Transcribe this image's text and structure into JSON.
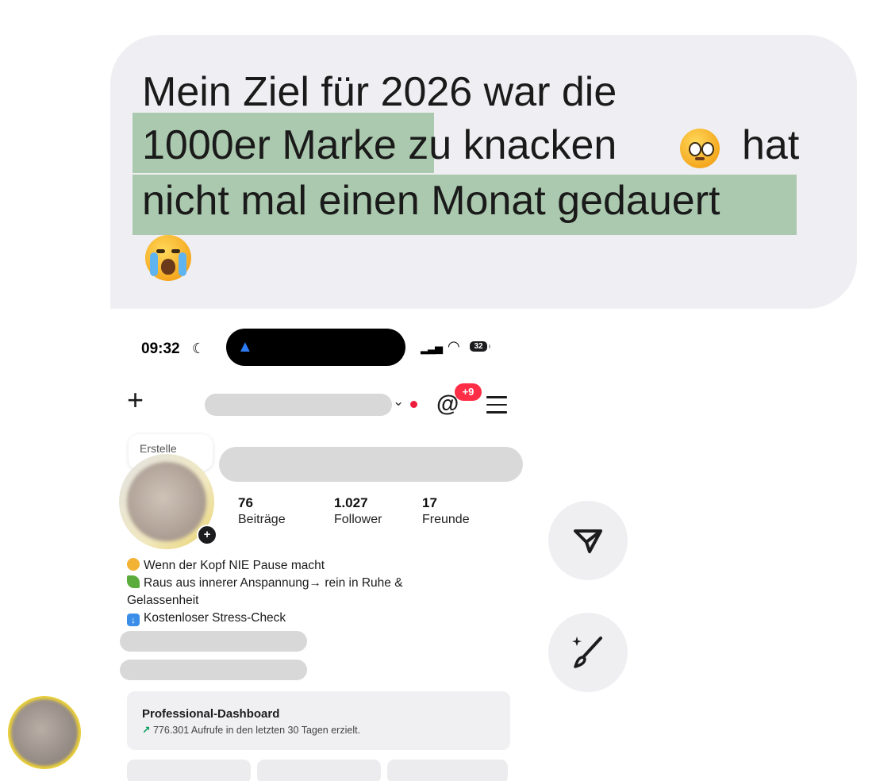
{
  "message": {
    "line1": "Mein Ziel für 2026 war die",
    "line2_highlight": "1000er Marke",
    "line2_rest": "zu knacken",
    "line2_end": "hat",
    "line3_highlight": "nicht mal einen Monat gedauert",
    "emoji_1": "pleading-face-emoji",
    "emoji_2": "crying-face-emoji",
    "highlight_color": "#abc9ae",
    "bubble_color": "#efeff3"
  },
  "screenshot": {
    "status_bar": {
      "time": "09:32",
      "battery": "32"
    },
    "header": {
      "threads_badge": "+9"
    },
    "note": {
      "label": "Erstelle"
    },
    "stats": [
      {
        "value": "76",
        "label": "Beiträge"
      },
      {
        "value": "1.027",
        "label": "Follower"
      },
      {
        "value": "17",
        "label": "Freunde"
      }
    ],
    "bio": {
      "line1": "Wenn der Kopf NIE Pause macht",
      "line2": "Raus aus innerer Anspannung→ rein in Ruhe &",
      "line3": "Gelassenheit",
      "line4": "Kostenloser Stress-Check"
    },
    "dashboard": {
      "title": "Professional-Dashboard",
      "arrow": "↗",
      "subtitle": "776.301 Aufrufe in den letzten 30 Tagen erzielt."
    }
  },
  "actions": {
    "share_icon": "send-icon",
    "edit_icon": "magic-brush-icon"
  }
}
